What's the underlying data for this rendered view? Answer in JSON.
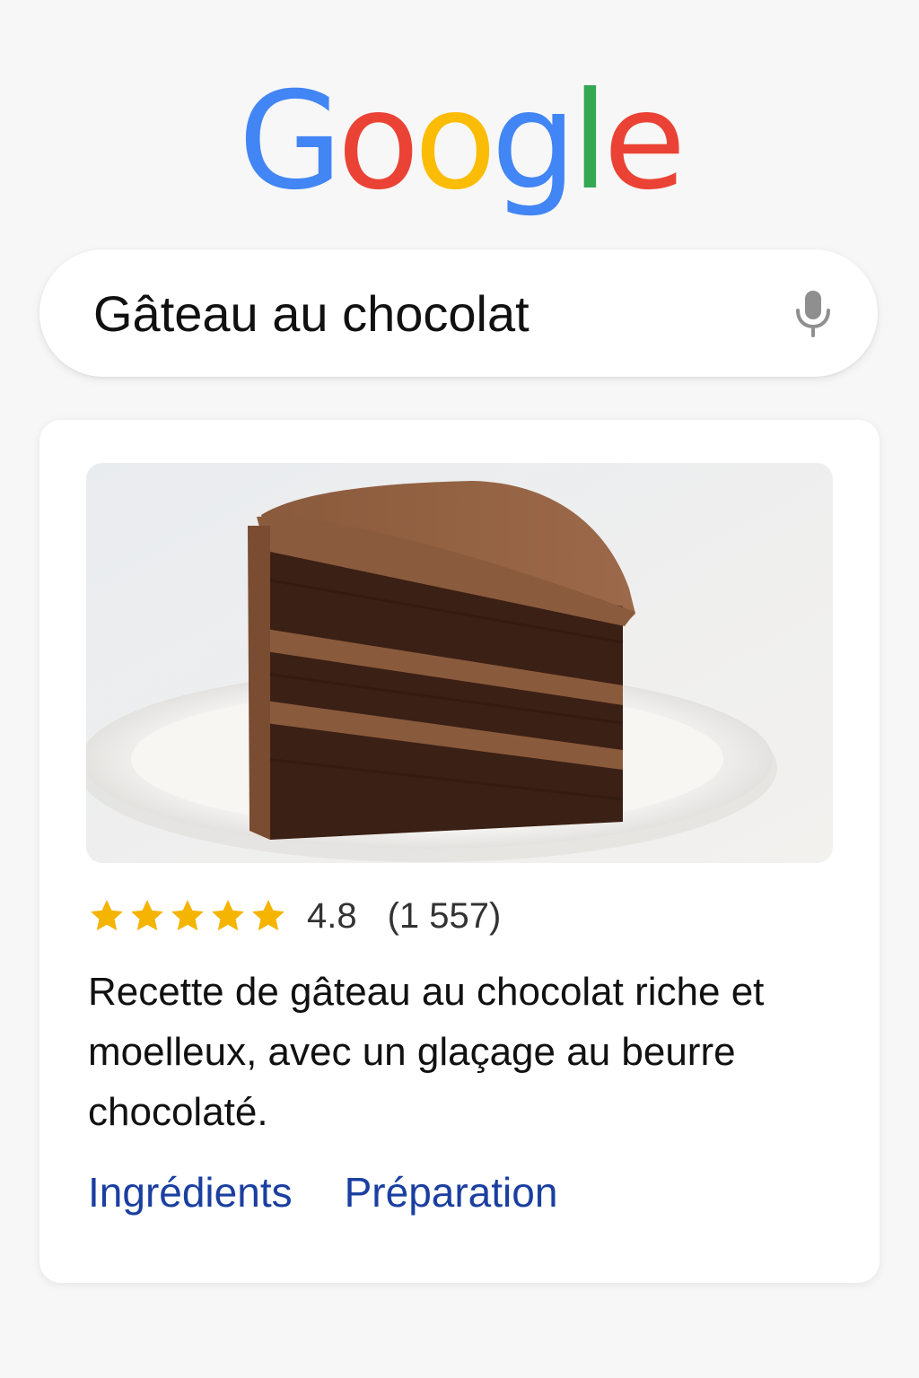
{
  "logo": {
    "text": "Google",
    "letters": [
      {
        "char": "G",
        "color": "#4285F4"
      },
      {
        "char": "o",
        "color": "#EA4335"
      },
      {
        "char": "o",
        "color": "#FBBC05"
      },
      {
        "char": "g",
        "color": "#4285F4"
      },
      {
        "char": "l",
        "color": "#34A853"
      },
      {
        "char": "e",
        "color": "#EA4335"
      }
    ]
  },
  "search": {
    "value": "Gâteau au chocolat",
    "icon": "microphone-icon"
  },
  "result": {
    "image": "chocolate-layer-cake-slice",
    "rating_stars": 5,
    "rating_value": "4.8",
    "rating_count": "(1 557)",
    "star_color": "#F4B400",
    "description": "Recette de gâteau au chocolat riche et moelleux, avec un glaçage au beurre chocolaté.",
    "links": {
      "ingredients": "Ingrédients",
      "preparation": "Préparation"
    },
    "link_color": "#1a3fa0"
  }
}
